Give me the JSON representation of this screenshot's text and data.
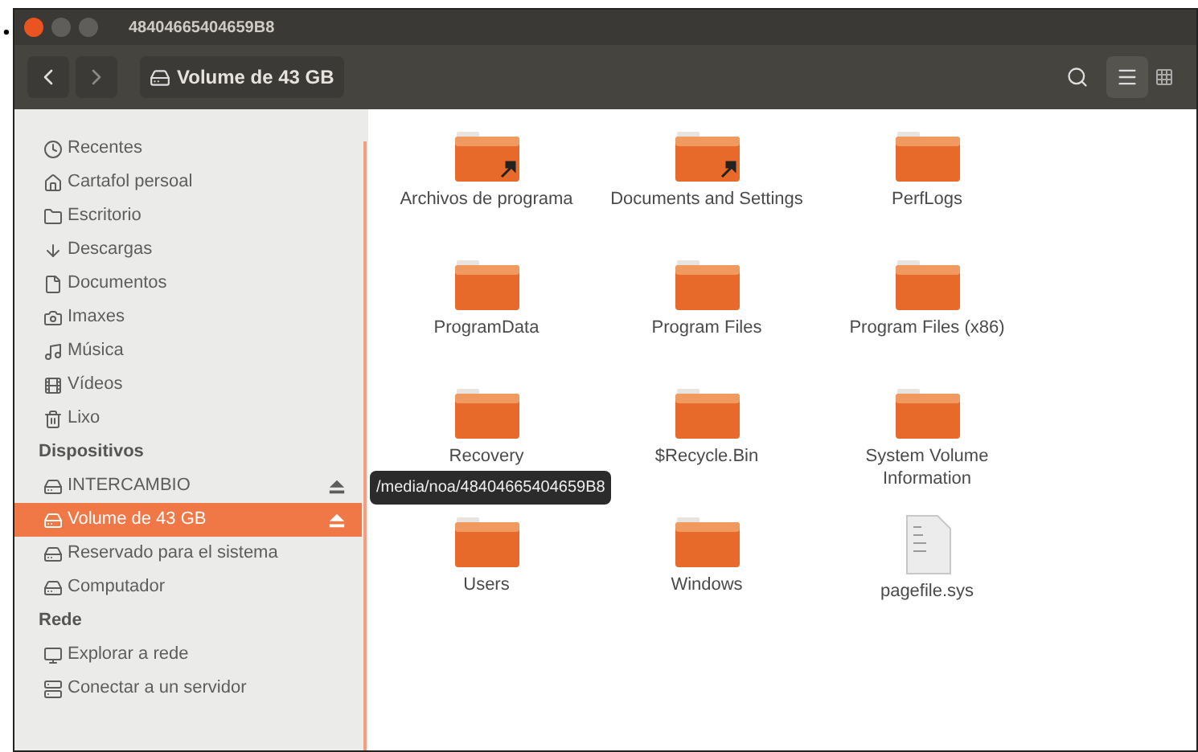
{
  "bullet": "•",
  "window": {
    "title": "48404665404659B8"
  },
  "toolbar": {
    "path_button": "Volume de 43 GB",
    "list_view_selected": true
  },
  "sidebar": {
    "sections": [
      {
        "items": [
          {
            "kind": "recent",
            "label": "Recentes",
            "selected": false
          },
          {
            "kind": "home",
            "label": "Cartafol persoal",
            "selected": false
          },
          {
            "kind": "desktop",
            "label": "Escritorio",
            "selected": false
          },
          {
            "kind": "download",
            "label": "Descargas",
            "selected": false
          },
          {
            "kind": "document",
            "label": "Documentos",
            "selected": false
          },
          {
            "kind": "camera",
            "label": "Imaxes",
            "selected": false
          },
          {
            "kind": "music",
            "label": "Música",
            "selected": false
          },
          {
            "kind": "video",
            "label": "Vídeos",
            "selected": false
          },
          {
            "kind": "trash",
            "label": "Lixo",
            "selected": false
          }
        ]
      },
      {
        "header": "Dispositivos",
        "items": [
          {
            "kind": "drive",
            "label": "INTERCAMBIO",
            "selected": false,
            "eject": true
          },
          {
            "kind": "drive",
            "label": "Volume de 43 GB",
            "selected": true,
            "eject": true
          },
          {
            "kind": "drive",
            "label": "Reservado para el sistema",
            "selected": false,
            "eject": false
          },
          {
            "kind": "drive",
            "label": "Computador",
            "selected": false,
            "eject": false
          }
        ]
      },
      {
        "header": "Rede",
        "items": [
          {
            "kind": "network",
            "label": "Explorar a rede",
            "selected": false
          },
          {
            "kind": "server",
            "label": "Conectar a un servidor",
            "selected": false
          }
        ]
      }
    ]
  },
  "tooltip": "/media/noa/48404665404659B8",
  "files": [
    {
      "kind": "folder",
      "name": "Archivos de programa",
      "link": true
    },
    {
      "kind": "folder",
      "name": "Documents and Settings",
      "link": true
    },
    {
      "kind": "folder",
      "name": "PerfLogs",
      "link": false
    },
    {
      "kind": "folder",
      "name": "ProgramData",
      "link": false
    },
    {
      "kind": "folder",
      "name": "Program Files",
      "link": false
    },
    {
      "kind": "folder",
      "name": "Program Files (x86)",
      "link": false
    },
    {
      "kind": "folder",
      "name": "Recovery",
      "link": false
    },
    {
      "kind": "folder",
      "name": "$Recycle.Bin",
      "link": false
    },
    {
      "kind": "folder",
      "name": "System Volume Information",
      "link": false
    },
    {
      "kind": "folder",
      "name": "Users",
      "link": false
    },
    {
      "kind": "folder",
      "name": "Windows",
      "link": false
    },
    {
      "kind": "file",
      "name": "pagefile.sys"
    }
  ]
}
